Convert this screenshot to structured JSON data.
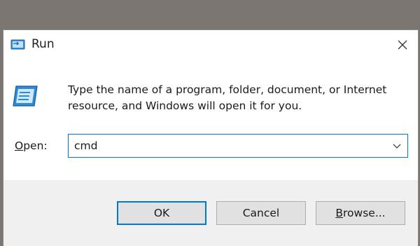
{
  "window": {
    "title": "Run",
    "close_icon": "close-icon",
    "title_icon": "run-icon"
  },
  "content": {
    "description": "Type the name of a program, folder, document, or Internet resource, and Windows will open it for you.",
    "open_label_accel": "O",
    "open_label_rest": "pen:",
    "open_value": "cmd",
    "dropdown_icon": "chevron-down-icon"
  },
  "buttons": {
    "ok_label": "OK",
    "cancel_label": "Cancel",
    "browse_accel": "B",
    "browse_rest": "rowse..."
  },
  "colors": {
    "accent": "#0078d7",
    "desktop": "#7b7672",
    "footer": "#f0f0f0"
  }
}
